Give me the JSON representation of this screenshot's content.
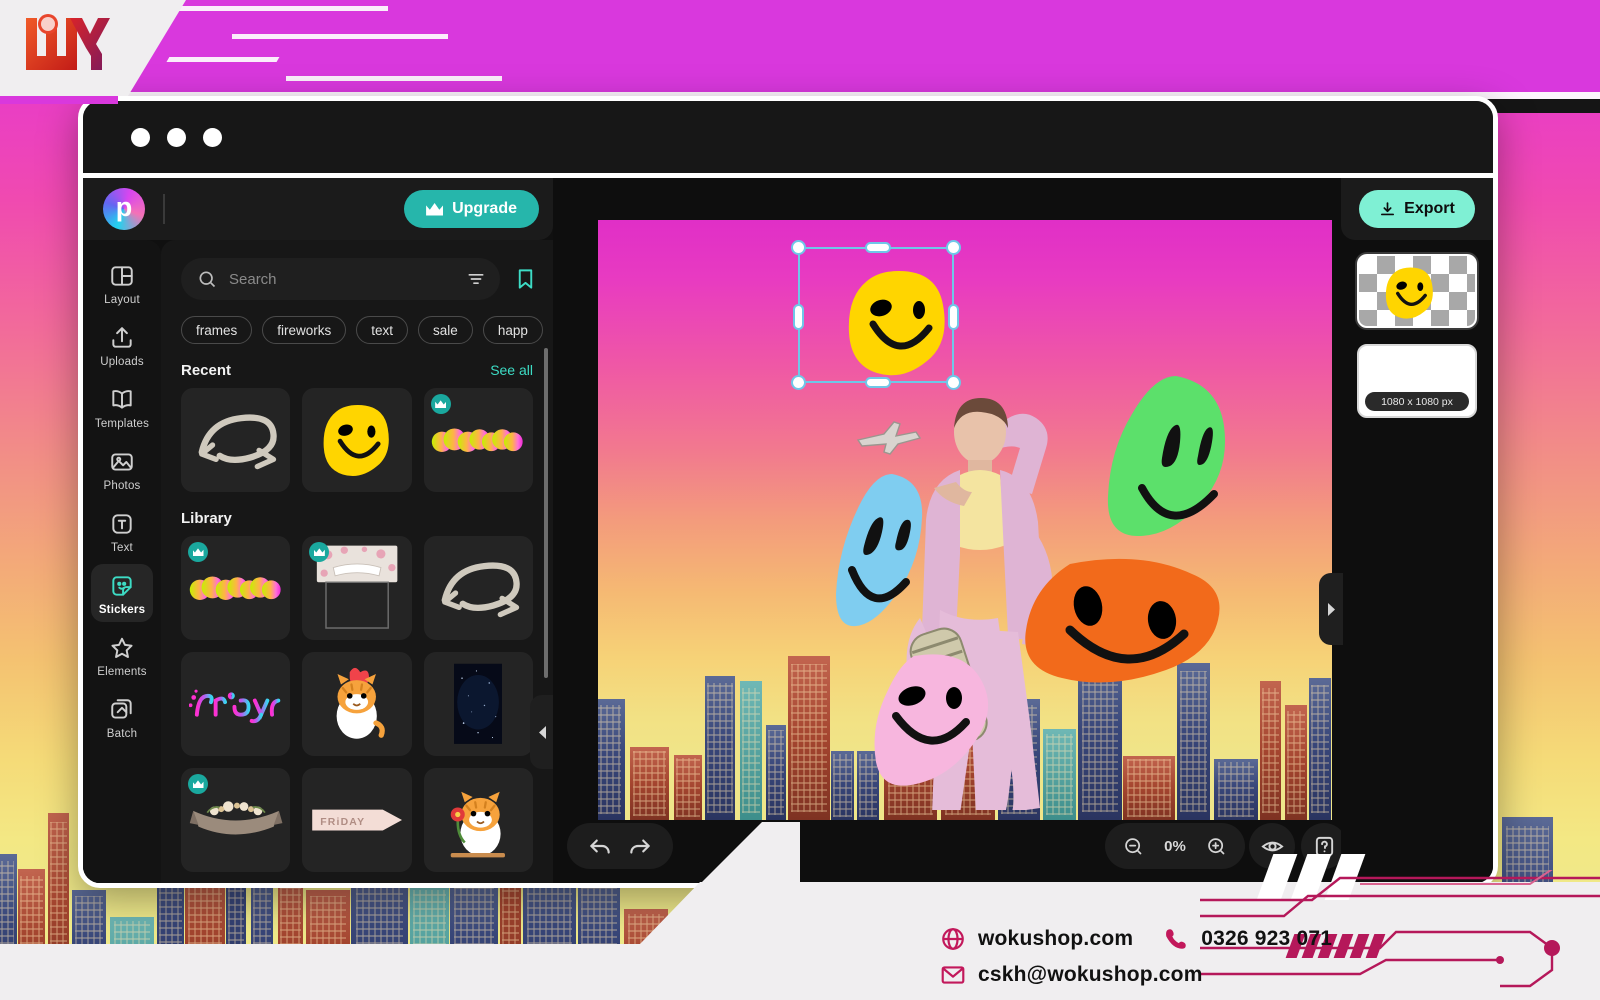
{
  "brand": {
    "logo_name": "wx-logo",
    "top_band_color": "#d938dd"
  },
  "window": {
    "titlebar_dots": 3
  },
  "app": {
    "logo_letter": "p",
    "upgrade_label": "Upgrade",
    "export_label": "Export"
  },
  "sidebar": {
    "items": [
      {
        "label": "Layout",
        "icon": "layout-icon",
        "active": false
      },
      {
        "label": "Uploads",
        "icon": "upload-icon",
        "active": false
      },
      {
        "label": "Templates",
        "icon": "templates-icon",
        "active": false
      },
      {
        "label": "Photos",
        "icon": "photos-icon",
        "active": false
      },
      {
        "label": "Text",
        "icon": "text-icon",
        "active": false
      },
      {
        "label": "Stickers",
        "icon": "stickers-icon",
        "active": true
      },
      {
        "label": "Elements",
        "icon": "star-icon",
        "active": false
      },
      {
        "label": "Batch",
        "icon": "batch-icon",
        "active": false
      }
    ]
  },
  "panel": {
    "search": {
      "placeholder": "Search",
      "value": ""
    },
    "filter_icon": "filter-icon",
    "bookmark_icon": "bookmark-icon",
    "chips": [
      "frames",
      "fireworks",
      "text",
      "sale",
      "happ"
    ],
    "recent": {
      "title": "Recent",
      "see_all": "See all",
      "items": [
        {
          "name": "swoosh-arrow-sticker",
          "pro": false
        },
        {
          "name": "yellow-smiley-sticker",
          "pro": false
        },
        {
          "name": "neon-blob-sticker",
          "pro": true
        }
      ]
    },
    "library": {
      "title": "Library",
      "items": [
        {
          "name": "neon-blob-sticker",
          "pro": true
        },
        {
          "name": "floral-card-sticker",
          "pro": true
        },
        {
          "name": "swoosh-arrow-sticker",
          "pro": false
        },
        {
          "name": "friday-script-sticker",
          "pro": false
        },
        {
          "name": "tiger-heart-sticker",
          "pro": false
        },
        {
          "name": "night-sky-sticker",
          "pro": false
        },
        {
          "name": "floral-banner-sticker",
          "pro": true
        },
        {
          "name": "friday-arrow-sticker",
          "pro": false,
          "label": "FRiDAY"
        },
        {
          "name": "tiger-flower-sticker",
          "pro": false
        }
      ]
    }
  },
  "canvas": {
    "selected_layer": "yellow-smiley-sticker",
    "stickers": [
      {
        "name": "yellow-smiley-sticker",
        "color": "#ffd500"
      },
      {
        "name": "green-smiley-sticker",
        "color": "#5ce06b"
      },
      {
        "name": "blue-smiley-sticker",
        "color": "#7fcdf0"
      },
      {
        "name": "orange-smiley-sticker",
        "color": "#f26a1b"
      },
      {
        "name": "pink-smiley-sticker",
        "color": "#f7b6de"
      }
    ]
  },
  "toolbar": {
    "undo_icon": "undo-icon",
    "redo_icon": "redo-icon",
    "zoom_out_icon": "zoom-out-icon",
    "zoom_in_icon": "zoom-in-icon",
    "zoom_level": "0%",
    "preview_icon": "eye-icon",
    "help_icon": "help-icon"
  },
  "right_panel": {
    "layers": [
      {
        "name": "sticker-layer-thumbnail",
        "selected": true,
        "size_label": ""
      },
      {
        "name": "background-layer-thumbnail",
        "selected": false,
        "size_label": "1080 x 1080 px"
      }
    ]
  },
  "footer": {
    "website": "wokushop.com",
    "phone": "0326 923 071",
    "email": "cskh@wokushop.com",
    "website_icon": "globe-icon",
    "phone_icon": "phone-icon",
    "email_icon": "mail-icon",
    "accent_color": "#c2185b"
  }
}
